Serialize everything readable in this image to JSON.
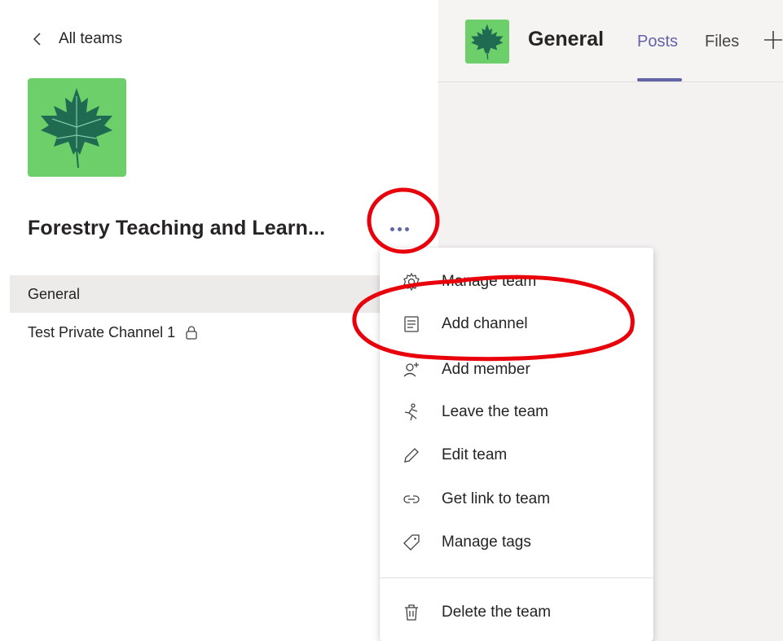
{
  "nav": {
    "back_label": "All teams"
  },
  "team": {
    "name": "Forestry Teaching and Learn..."
  },
  "channels": [
    {
      "label": "General",
      "selected": true
    },
    {
      "label": "Test Private Channel 1",
      "private": true
    }
  ],
  "channel_header": {
    "title": "General",
    "tabs": [
      {
        "label": "Posts",
        "active": true
      },
      {
        "label": "Files",
        "active": false
      }
    ]
  },
  "menu": {
    "items": [
      {
        "label": "Manage team",
        "icon": "gear-icon"
      },
      {
        "label": "Add channel",
        "icon": "add-channel-icon"
      },
      {
        "label": "Add member",
        "icon": "add-member-icon"
      },
      {
        "label": "Leave the team",
        "icon": "leave-icon"
      },
      {
        "label": "Edit team",
        "icon": "pencil-icon"
      },
      {
        "label": "Get link to team",
        "icon": "link-icon"
      },
      {
        "label": "Manage tags",
        "icon": "tag-icon"
      },
      {
        "label": "Delete the team",
        "icon": "trash-icon"
      }
    ]
  },
  "colors": {
    "accent": "#6264a7",
    "logo_bg": "#6ccf6a",
    "leaf": "#1e6b52",
    "annotation": "#e8000b"
  }
}
